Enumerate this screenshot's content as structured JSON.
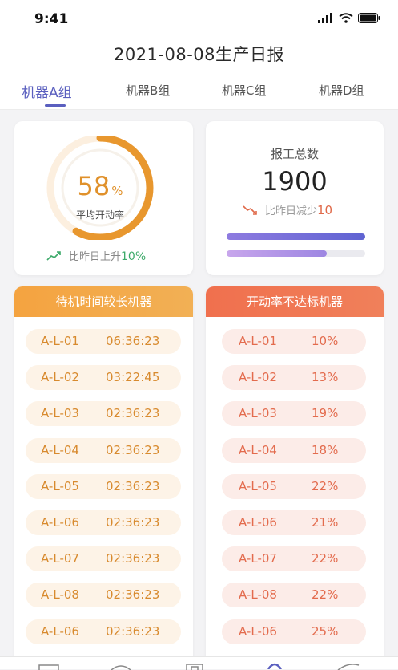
{
  "status": {
    "time": "9:41"
  },
  "header": {
    "title": "2021-08-08生产日报"
  },
  "tabs": [
    {
      "label": "机器A组"
    },
    {
      "label": "机器B组"
    },
    {
      "label": "机器C组"
    },
    {
      "label": "机器D组"
    }
  ],
  "utilization": {
    "value": "58",
    "unit": "%",
    "fraction": 0.58,
    "label": "平均开动率",
    "trend_text": "比昨日上升",
    "trend_value": "10%"
  },
  "report": {
    "title": "报工总数",
    "total": "1900",
    "trend_text": "比昨日减少",
    "trend_value": "10",
    "bar1_fraction": 1.0,
    "bar2_fraction": 0.72
  },
  "idle_panel": {
    "title": "待机时间较长机器",
    "rows": [
      {
        "code": "A-L-01",
        "value": "06:36:23"
      },
      {
        "code": "A-L-02",
        "value": "03:22:45"
      },
      {
        "code": "A-L-03",
        "value": "02:36:23"
      },
      {
        "code": "A-L-04",
        "value": "02:36:23"
      },
      {
        "code": "A-L-05",
        "value": "02:36:23"
      },
      {
        "code": "A-L-06",
        "value": "02:36:23"
      },
      {
        "code": "A-L-07",
        "value": "02:36:23"
      },
      {
        "code": "A-L-08",
        "value": "02:36:23"
      },
      {
        "code": "A-L-06",
        "value": "02:36:23"
      }
    ]
  },
  "low_rate_panel": {
    "title": "开动率不达标机器",
    "rows": [
      {
        "code": "A-L-01",
        "value": "10%"
      },
      {
        "code": "A-L-02",
        "value": "13%"
      },
      {
        "code": "A-L-03",
        "value": "19%"
      },
      {
        "code": "A-L-04",
        "value": "18%"
      },
      {
        "code": "A-L-05",
        "value": "22%"
      },
      {
        "code": "A-L-06",
        "value": "21%"
      },
      {
        "code": "A-L-07",
        "value": "22%"
      },
      {
        "code": "A-L-08",
        "value": "22%"
      },
      {
        "code": "A-L-06",
        "value": "25%"
      }
    ]
  },
  "colors": {
    "accent": "#5a5fbf",
    "orange": "#f4a340",
    "red_orange": "#f0704e",
    "gauge": "#e8972e",
    "bar1": "#6a66d6",
    "bar2": "#b59ae6"
  }
}
